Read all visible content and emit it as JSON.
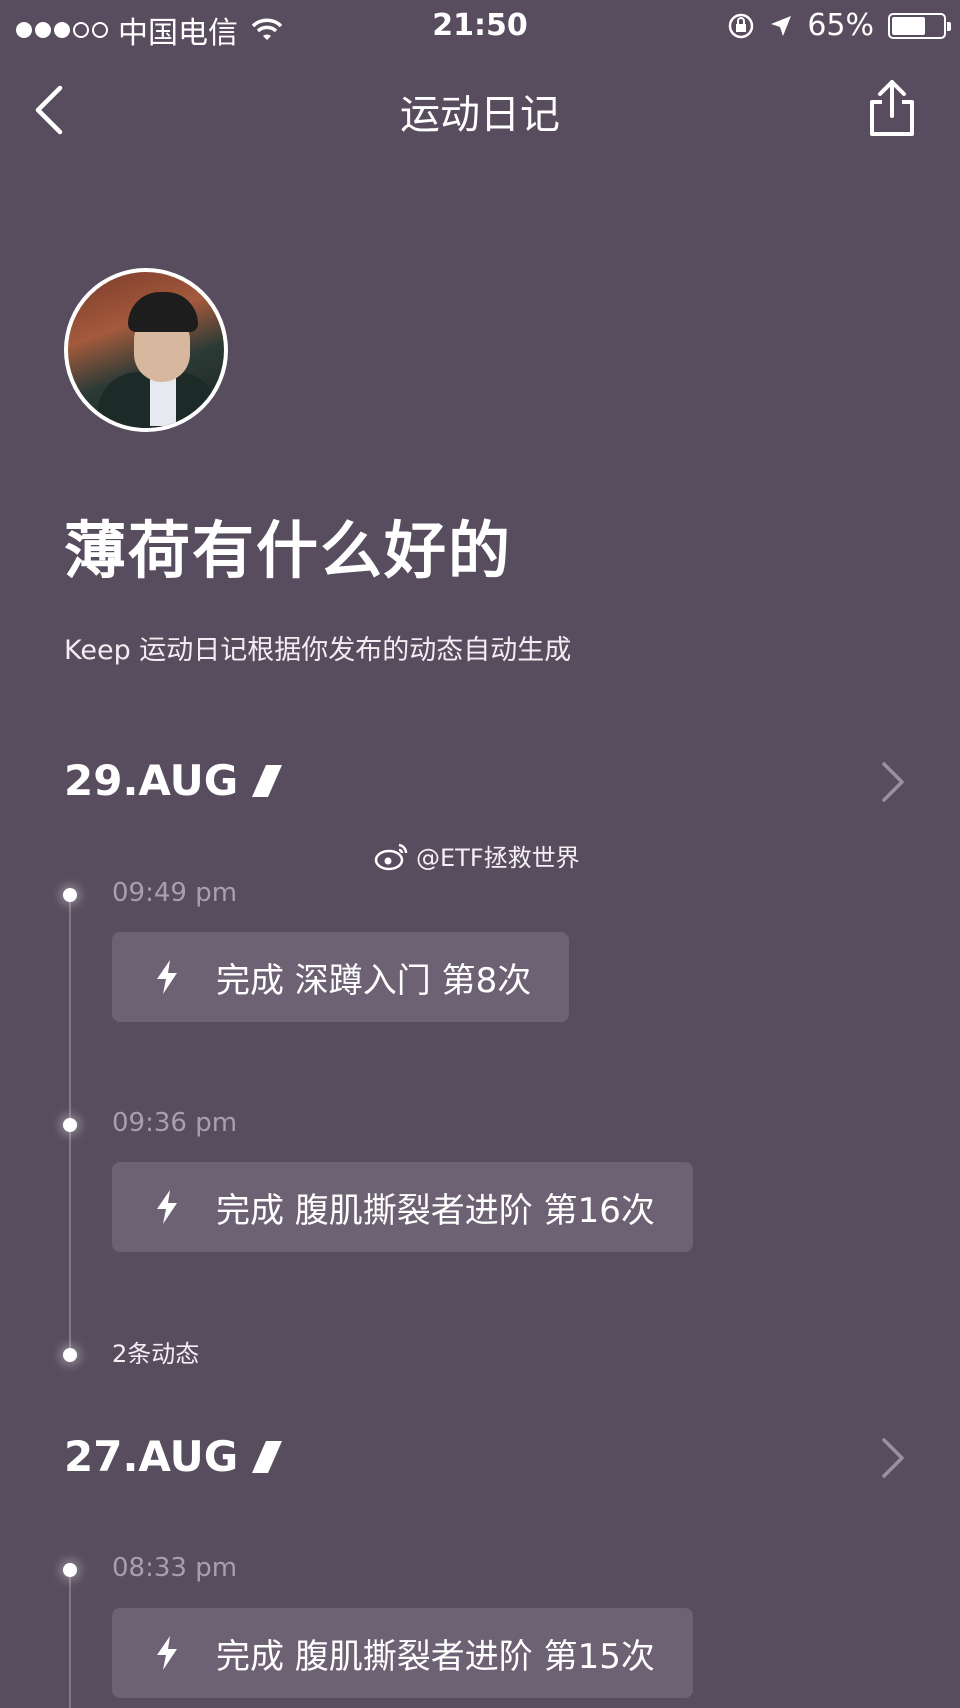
{
  "status_bar": {
    "carrier": "中国电信",
    "time": "21:50",
    "battery_percent": "65%",
    "battery_level": 0.65,
    "signal_bars_filled": 3,
    "signal_bars_total": 5
  },
  "nav": {
    "title": "运动日记"
  },
  "profile": {
    "username": "薄荷有什么好的",
    "subtitle": "Keep 运动日记根据你发布的动态自动生成"
  },
  "watermark": "@ETF拯救世界",
  "days": [
    {
      "date": "29.AUG",
      "entries": [
        {
          "time": "09:49 pm",
          "text": "完成 深蹲入门 第8次"
        },
        {
          "time": "09:36 pm",
          "text": "完成 腹肌撕裂者进阶 第16次"
        }
      ],
      "summary": "2条动态"
    },
    {
      "date": "27.AUG",
      "entries": [
        {
          "time": "08:33 pm",
          "text": "完成 腹肌撕裂者进阶 第15次"
        }
      ]
    }
  ],
  "icons": {
    "back": "chevron-left-icon",
    "share": "share-icon",
    "entry": "lightning-bolt-icon",
    "date_marker": "slash-icon",
    "day_open": "chevron-right-icon",
    "watermark": "weibo-icon"
  },
  "colors": {
    "background": "#584d5e",
    "card": "#6c6273",
    "muted_text": "#a89fad"
  }
}
